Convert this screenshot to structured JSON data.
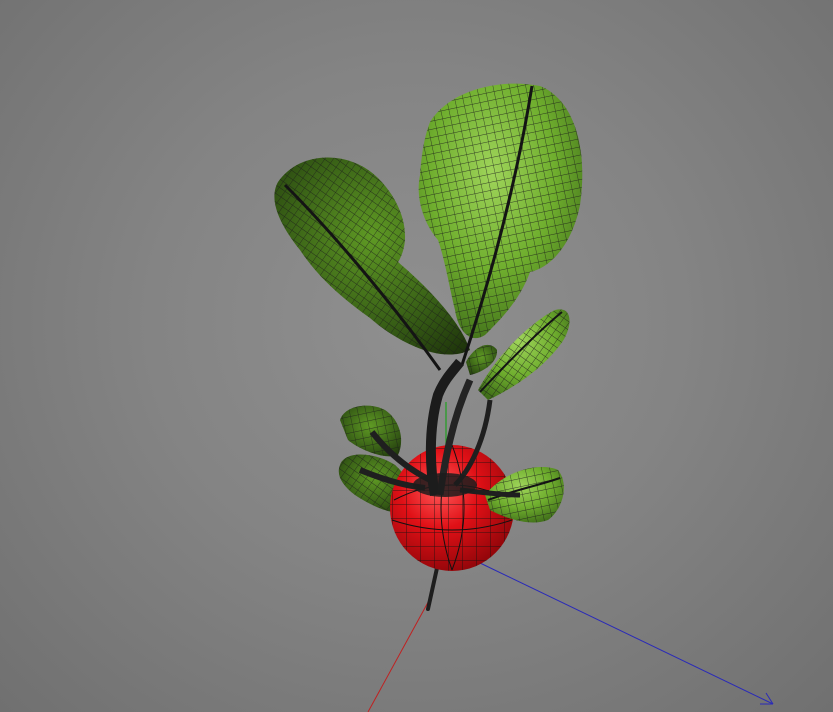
{
  "viewport": {
    "background_color": "#858585",
    "model": {
      "subject": "radish",
      "render_mode": "shaded-wireframe",
      "root_color": "#e01016",
      "leaf_color": "#6fae2e",
      "wire_color": "#1b1b1b"
    },
    "axes": {
      "x_axis_color": "#c02020",
      "z_axis_color": "#2a2ab8",
      "y_axis_color": "#20a020"
    }
  }
}
